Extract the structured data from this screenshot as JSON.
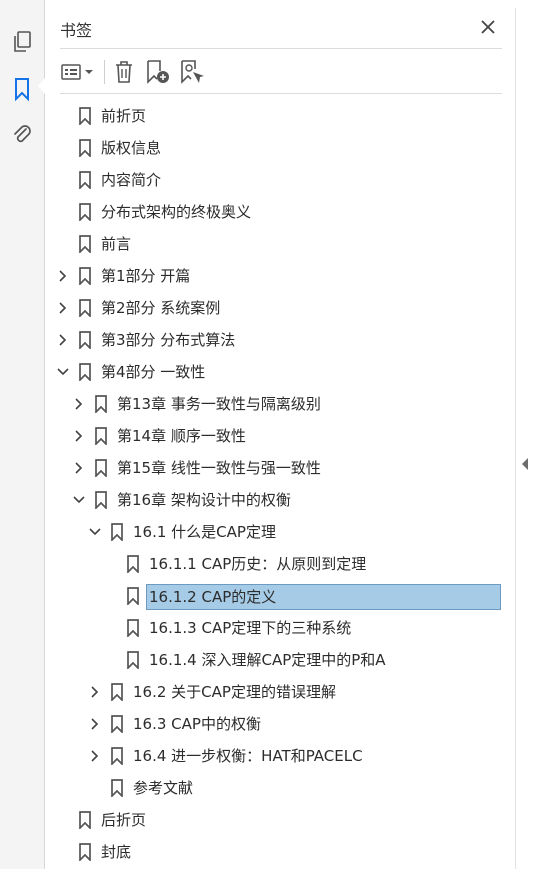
{
  "panel": {
    "title": "书签"
  },
  "rail": {
    "items": [
      {
        "icon": "pages-icon"
      },
      {
        "icon": "bookmark-icon",
        "active": true
      },
      {
        "icon": "paperclip-icon"
      }
    ]
  },
  "toolbar": {
    "buttons": [
      "options-menu-icon",
      "trash-icon",
      "new-bookmark-icon",
      "new-bookmark-from-structure-icon"
    ]
  },
  "bookmarks": [
    {
      "label": "前折页",
      "level": 0,
      "expander": "none"
    },
    {
      "label": "版权信息",
      "level": 0,
      "expander": "none"
    },
    {
      "label": "内容简介",
      "level": 0,
      "expander": "none"
    },
    {
      "label": "分布式架构的终极奥义",
      "level": 0,
      "expander": "none"
    },
    {
      "label": "前言",
      "level": 0,
      "expander": "none"
    },
    {
      "label": "第1部分 开篇",
      "level": 0,
      "expander": "collapsed"
    },
    {
      "label": "第2部分 系统案例",
      "level": 0,
      "expander": "collapsed"
    },
    {
      "label": "第3部分 分布式算法",
      "level": 0,
      "expander": "collapsed"
    },
    {
      "label": "第4部分 一致性",
      "level": 0,
      "expander": "expanded"
    },
    {
      "label": "第13章 事务一致性与隔离级别",
      "level": 1,
      "expander": "collapsed"
    },
    {
      "label": "第14章 顺序一致性",
      "level": 1,
      "expander": "collapsed"
    },
    {
      "label": "第15章 线性一致性与强一致性",
      "level": 1,
      "expander": "collapsed"
    },
    {
      "label": "第16章 架构设计中的权衡",
      "level": 1,
      "expander": "expanded"
    },
    {
      "label": "16.1 什么是CAP定理",
      "level": 2,
      "expander": "expanded"
    },
    {
      "label": "16.1.1 CAP历史：从原则到定理",
      "level": 3,
      "expander": "none"
    },
    {
      "label": "16.1.2 CAP的定义",
      "level": 3,
      "expander": "none",
      "selected": true
    },
    {
      "label": "16.1.3 CAP定理下的三种系统",
      "level": 3,
      "expander": "none"
    },
    {
      "label": "16.1.4 深入理解CAP定理中的P和A",
      "level": 3,
      "expander": "none"
    },
    {
      "label": "16.2 关于CAP定理的错误理解",
      "level": 2,
      "expander": "collapsed"
    },
    {
      "label": "16.3 CAP中的权衡",
      "level": 2,
      "expander": "collapsed"
    },
    {
      "label": "16.4 进一步权衡：HAT和PACELC",
      "level": 2,
      "expander": "collapsed"
    },
    {
      "label": "参考文献",
      "level": 2,
      "expander": "none"
    },
    {
      "label": "后折页",
      "level": 0,
      "expander": "none"
    },
    {
      "label": "封底",
      "level": 0,
      "expander": "none"
    }
  ],
  "colors": {
    "selection_bg": "#a6cbe6",
    "selection_border": "#6c9ac0",
    "active_icon": "#1473e6"
  }
}
